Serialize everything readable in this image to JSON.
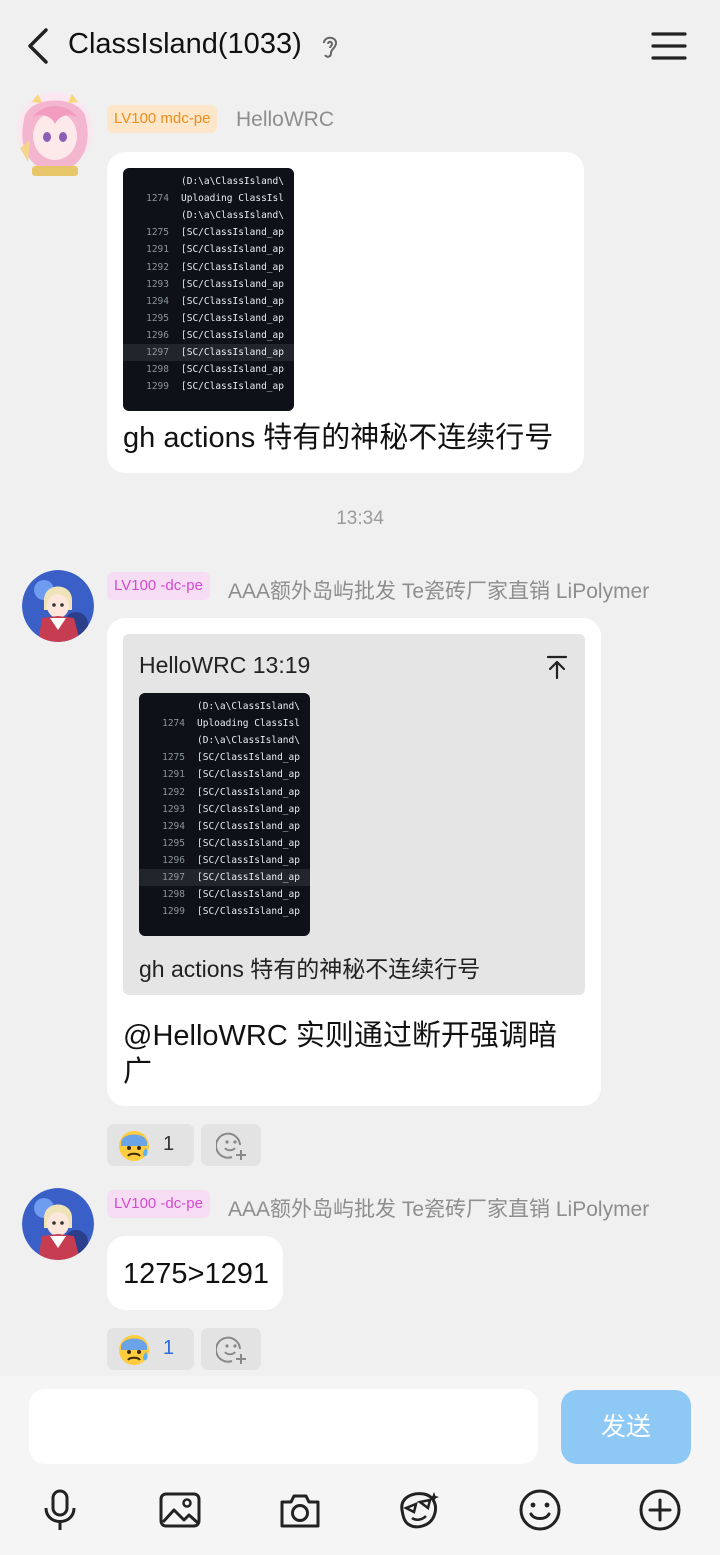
{
  "header": {
    "title": "ClassIsland(1033)"
  },
  "code_image": {
    "lines": [
      {
        "num": "",
        "text": "(D:\\a\\ClassIsland\\"
      },
      {
        "num": "1274",
        "text": "Uploading ClassIsl"
      },
      {
        "num": "",
        "text": "(D:\\a\\ClassIsland\\"
      },
      {
        "num": "1275",
        "text": "[SC/ClassIsland_ap"
      },
      {
        "num": "1291",
        "text": "[SC/ClassIsland_ap"
      },
      {
        "num": "1292",
        "text": "[SC/ClassIsland_ap"
      },
      {
        "num": "1293",
        "text": "[SC/ClassIsland_ap"
      },
      {
        "num": "1294",
        "text": "[SC/ClassIsland_ap"
      },
      {
        "num": "1295",
        "text": "[SC/ClassIsland_ap"
      },
      {
        "num": "1296",
        "text": "[SC/ClassIsland_ap"
      },
      {
        "num": "1297",
        "text": "[SC/ClassIsland_ap"
      },
      {
        "num": "1298",
        "text": "[SC/ClassIsland_ap"
      },
      {
        "num": "1299",
        "text": "[SC/ClassIsland_ap"
      }
    ]
  },
  "messages": [
    {
      "badge": "LV100 mdc-pe",
      "sender": "HelloWRC",
      "text": "gh actions 特有的神秘不连续行号"
    },
    {
      "badge": "LV100 -dc-pe",
      "sender": "AAA额外岛屿批发 Te瓷砖厂家直销 LiPolymer",
      "reply": {
        "header": "HelloWRC 13:19",
        "text": "gh actions 特有的神秘不连续行号"
      },
      "text_line1": "@HelloWRC 实则通过断开强调暗",
      "text_line2": "广",
      "reaction": {
        "emoji": "anxious-sweat-emoji",
        "count": "1"
      }
    },
    {
      "badge": "LV100 -dc-pe",
      "sender": "AAA额外岛屿批发 Te瓷砖厂家直销 LiPolymer",
      "text": "1275>1291",
      "reaction": {
        "emoji": "anxious-sweat-emoji",
        "count": "1"
      }
    }
  ],
  "timestamp": "13:34",
  "input": {
    "send_label": "发送"
  },
  "toolbar": [
    "microphone-icon",
    "image-icon",
    "camera-icon",
    "sticker-icon",
    "emoji-icon",
    "plus-icon"
  ],
  "colors": {
    "send_button": "#8ec9f5",
    "badge_orange": "#f08d1b",
    "badge_pink": "#d24bd0",
    "background": "#f0f0f0"
  }
}
